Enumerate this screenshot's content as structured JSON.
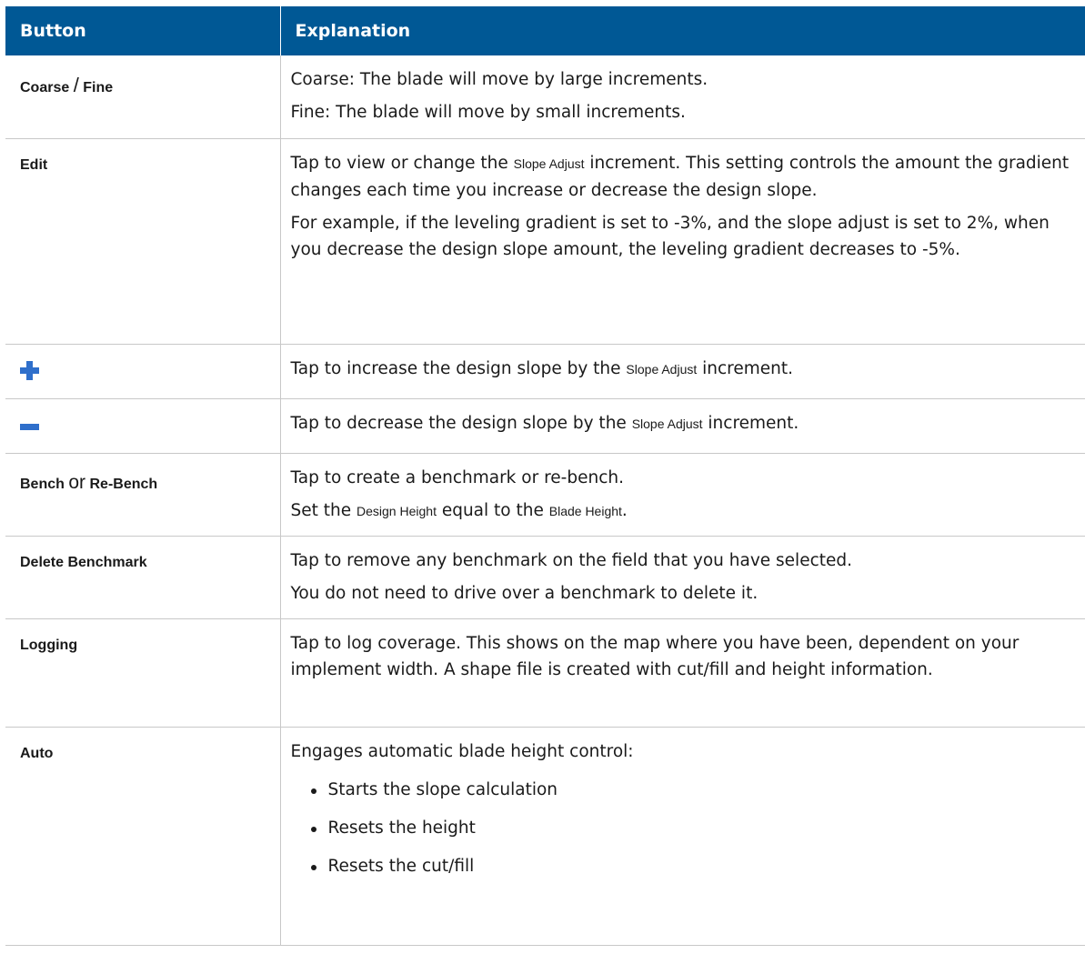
{
  "header": {
    "col_button": "Button",
    "col_explanation": "Explanation"
  },
  "colors": {
    "header_bg": "#005895",
    "icon_blue": "#2f6fcb"
  },
  "rows": [
    {
      "button": {
        "a": "Coarse",
        "sep": "/",
        "b": "Fine"
      },
      "lines": [
        "Coarse: The blade will move by large increments.",
        "Fine: The blade will move by small increments."
      ]
    },
    {
      "button": "Edit",
      "p1": {
        "pre": "Tap to view or change the ",
        "ui": "Slope Adjust",
        "post": " increment. This setting controls the amount the gradient changes each time you increase or decrease the design slope."
      },
      "p2": "For example, if the leveling gradient is set to -3%, and the slope adjust is set to 2%, when you decrease the design slope amount, the leveling gradient decreases to -5%."
    },
    {
      "button_icon": "plus-icon",
      "p1": {
        "pre": "Tap to increase the design slope by the ",
        "ui": "Slope Adjust",
        "post": " increment."
      }
    },
    {
      "button_icon": "minus-icon",
      "p1": {
        "pre": "Tap to decrease the design slope by the ",
        "ui": "Slope Adjust",
        "post": " increment."
      }
    },
    {
      "button": {
        "a": "Bench",
        "sep": "or",
        "b": "Re-Bench"
      },
      "p1": "Tap to create a benchmark or re-bench.",
      "p2": {
        "pre": "Set the ",
        "ui1": "Design Height",
        "mid": " equal to the ",
        "ui2": "Blade Height",
        "post": "."
      }
    },
    {
      "button": "Delete Benchmark",
      "lines": [
        "Tap to remove any benchmark on the field that you have selected.",
        "You do not need to drive over a benchmark to delete it."
      ]
    },
    {
      "button": "Logging",
      "p1": "Tap to log coverage. This shows on the map where you have been, dependent on your implement width. A shape file is created with cut/fill and height information."
    },
    {
      "button": "Auto",
      "p1": "Engages automatic blade height control:",
      "bullets": [
        "Starts the slope calculation",
        "Resets the height",
        "Resets the cut/fill"
      ]
    }
  ]
}
